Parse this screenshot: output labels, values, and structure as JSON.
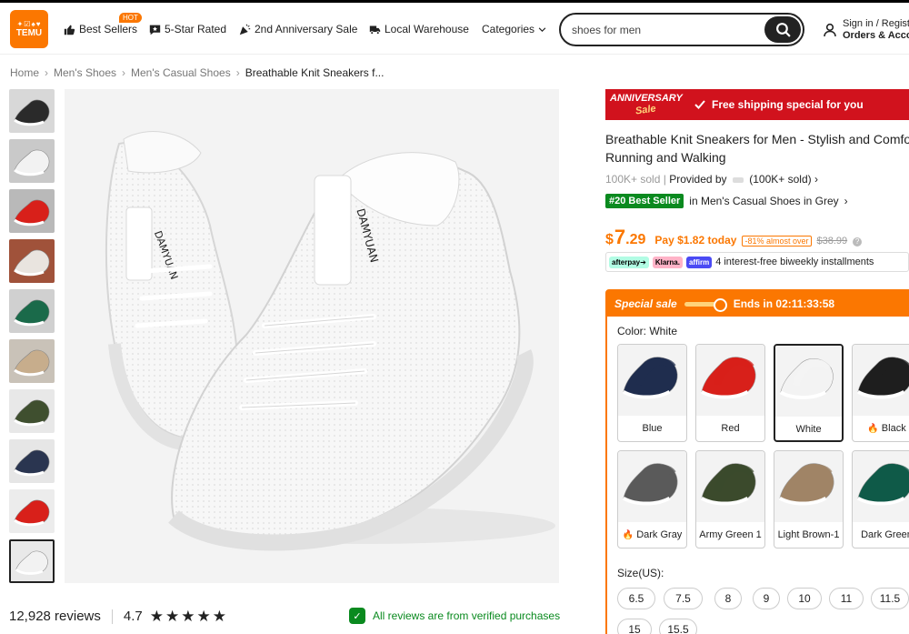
{
  "header": {
    "logo_top": "✦☑♠♥",
    "logo_name": "TEMU",
    "nav": [
      {
        "label": "Best Sellers",
        "icon": "thumbs-up-icon"
      },
      {
        "label": "5-Star Rated",
        "icon": "star-chat-icon"
      },
      {
        "label": "2nd Anniversary Sale",
        "icon": "party-popper-icon"
      },
      {
        "label": "Local Warehouse",
        "icon": "truck-icon"
      },
      {
        "label": "Categories",
        "icon": "chevron-down-icon"
      }
    ],
    "hot_badge": "HOT",
    "search_value": "shoes for men",
    "signin_line1": "Sign in / Register",
    "signin_line2": "Orders & Account"
  },
  "breadcrumb": [
    "Home",
    "Men's Shoes",
    "Men's Casual Shoes",
    "Breathable Knit Sneakers f..."
  ],
  "thumbnails": [
    {
      "color": "#2a2a2a",
      "bg": "#d8d8d8"
    },
    {
      "color": "#f2f2f2",
      "bg": "#c9c9c9"
    },
    {
      "color": "#d8201a",
      "bg": "#b9b9b9"
    },
    {
      "color": "#e9e4df",
      "bg": "#a0523a"
    },
    {
      "color": "#1a6a4a",
      "bg": "#d0d0d0"
    },
    {
      "color": "#c7ad8c",
      "bg": "#c9c2b8"
    },
    {
      "color": "#3f4f2f",
      "bg": "#e8e8e8"
    },
    {
      "color": "#2a3550",
      "bg": "#e6e6e6"
    },
    {
      "color": "#d8201a",
      "bg": "#ececec"
    },
    {
      "color": "#f2f2f2",
      "bg": "#e9e9e9"
    }
  ],
  "reviews": {
    "count": "12,928 reviews",
    "rating": "4.7",
    "verified": "All reviews are from verified purchases"
  },
  "product": {
    "anniversary_top": "ANNIVERSARY",
    "anniversary_bottom": "Sale",
    "shipping": "Free shipping special for you",
    "title_line1": "Breathable Knit Sneakers for Men - Stylish and Comfortable",
    "title_line2": "Running and Walking",
    "sold": "100K+ sold",
    "provided_by": "Provided by",
    "provider_sold": "(100K+ sold)",
    "best_badge": "#20 Best Seller",
    "best_text": "in Men's Casual Shoes in Grey",
    "price_dollar": "$",
    "price_int": "7",
    "price_cents": ".29",
    "pay_today": "Pay $1.82 today",
    "discount": "-81% almost over",
    "original_price": "$38.99",
    "pay_logos": [
      "afterpay➔",
      "Klarna.",
      "affirm"
    ],
    "installments": "4 interest-free biweekly installments"
  },
  "sale": {
    "label": "Special sale",
    "ends": "Ends in 02:11:33:58",
    "color_label": "Color: White",
    "colors": [
      {
        "name": "Blue",
        "hex": "#1f2d4e",
        "fire": false
      },
      {
        "name": "Red",
        "hex": "#d8201a",
        "fire": false
      },
      {
        "name": "White",
        "hex": "#f3f3f3",
        "fire": false,
        "selected": true
      },
      {
        "name": "Black",
        "hex": "#1e1e1e",
        "fire": true
      },
      {
        "name": "Dark Gray",
        "hex": "#5a5a5a",
        "fire": true
      },
      {
        "name": "Army Green 1",
        "hex": "#3b4a2c",
        "fire": false
      },
      {
        "name": "Light Brown-1",
        "hex": "#a08466",
        "fire": false
      },
      {
        "name": "Dark Green",
        "hex": "#0f5a48",
        "fire": false
      }
    ],
    "size_label": "Size(US):",
    "sizes": [
      "6.5",
      "7.5",
      "8",
      "9",
      "10",
      "11",
      "11.5",
      "15",
      "15.5"
    ]
  },
  "colors": {
    "accent": "#fb7701",
    "red": "#d1121d",
    "green": "#0a8a1f"
  }
}
